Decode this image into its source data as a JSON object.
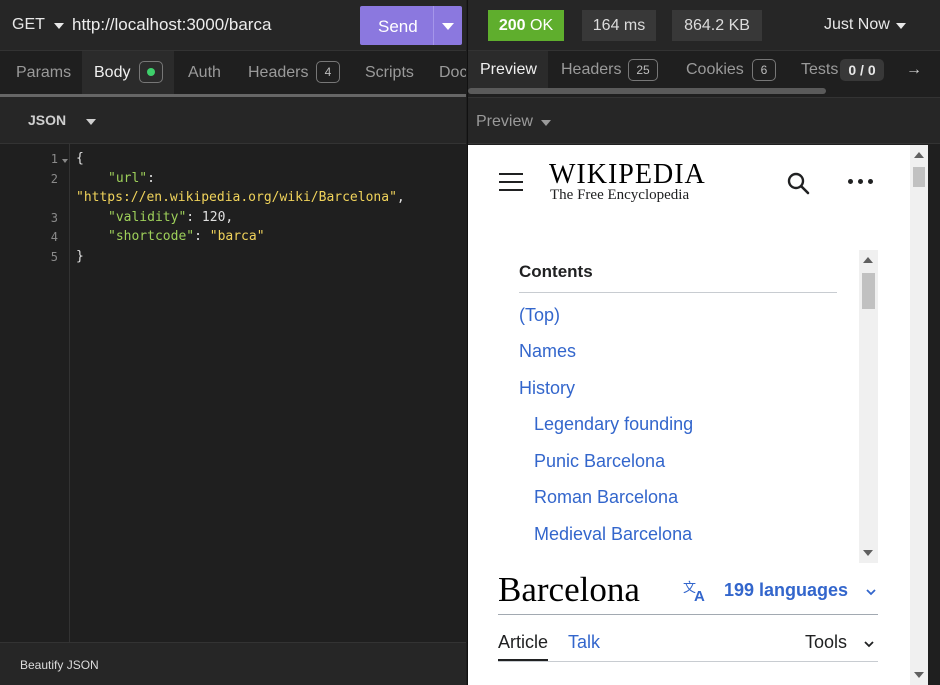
{
  "request": {
    "method": "GET",
    "url": "http://localhost:3000/barca",
    "send_label": "Send",
    "tabs": [
      {
        "label": "Params"
      },
      {
        "label": "Body"
      },
      {
        "label": "Auth"
      },
      {
        "label": "Headers",
        "count": "4"
      },
      {
        "label": "Scripts"
      },
      {
        "label": "Doc"
      }
    ],
    "body_format": "JSON",
    "editor": {
      "line_numbers": [
        "1",
        "2",
        "3",
        "4",
        "5"
      ],
      "lines": [
        {
          "p": "{"
        },
        {
          "k": "\"url\"",
          "p": ":"
        },
        {
          "s": "\"https://en.wikipedia.org/wiki/Barcelona\"",
          "p": ","
        },
        {
          "k": "\"validity\"",
          "p": ": 120,"
        },
        {
          "k": "\"shortcode\"",
          "p": ": ",
          "s": "\"barca\""
        },
        {
          "p": "}"
        }
      ]
    },
    "beautify_label": "Beautify JSON"
  },
  "response": {
    "status_code": "200",
    "status_text": "OK",
    "time": "164 ms",
    "size": "864.2 KB",
    "when": "Just Now",
    "tabs": [
      {
        "label": "Preview"
      },
      {
        "label": "Headers",
        "count": "25"
      },
      {
        "label": "Cookies",
        "count": "6"
      },
      {
        "label": "Tests",
        "count": "0 / 0"
      }
    ],
    "arrow_glyph": "→",
    "preview_mode": "Preview",
    "colors": {
      "accent": "#8b78df",
      "ok": "#5fae2d",
      "link": "#3366cc"
    }
  },
  "wiki": {
    "wordmark": "WIKIPEDIA",
    "tagline": "The Free Encyclopedia",
    "toc_title": "Contents",
    "toc": [
      "(Top)",
      "Names",
      "History",
      "Legendary founding",
      "Punic Barcelona",
      "Roman Barcelona",
      "Medieval Barcelona"
    ],
    "article_title": "Barcelona",
    "languages": "199 languages",
    "tab_article": "Article",
    "tab_talk": "Talk",
    "tab_tools": "Tools"
  }
}
